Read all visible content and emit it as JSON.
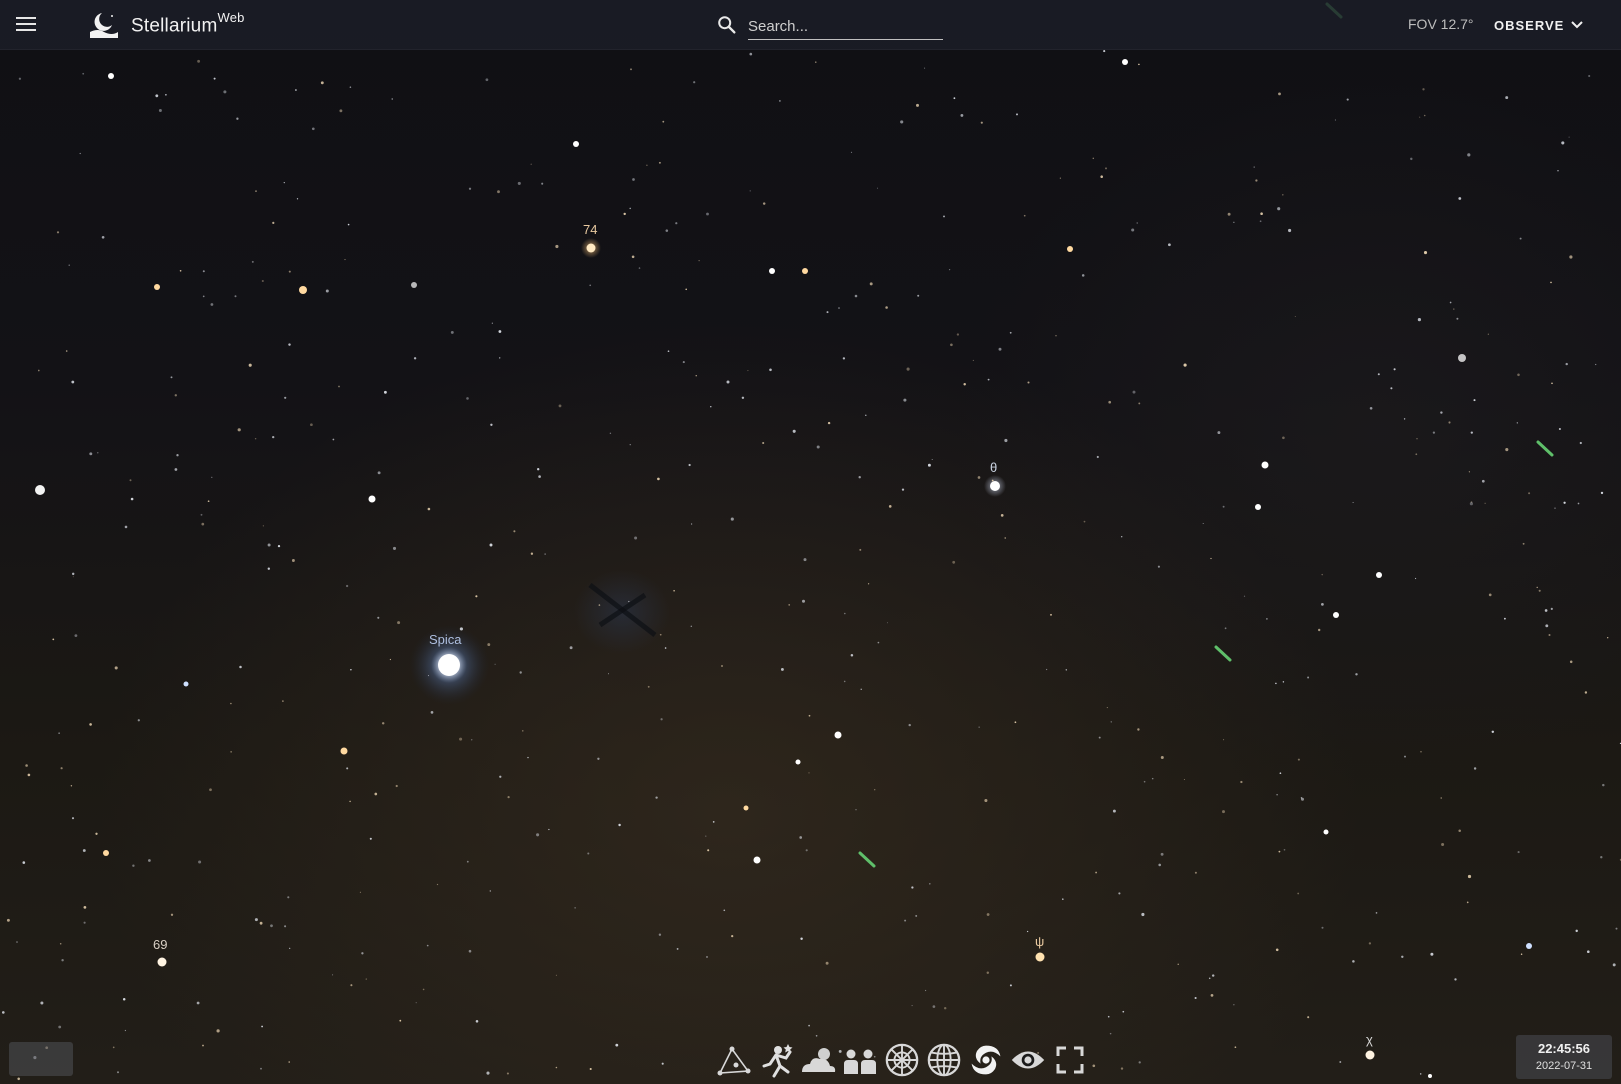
{
  "app": {
    "title": "Stellarium",
    "title_suffix": "Web"
  },
  "search": {
    "placeholder": "Search..."
  },
  "header": {
    "fov": "FOV 12.7°",
    "observe_label": "OBSERVE"
  },
  "sky_labels": [
    {
      "name": "Spica",
      "color": "#aebfe0"
    },
    {
      "name": "74",
      "color": "#e8c9a0"
    },
    {
      "name": "θ",
      "color": "#c9d2e0"
    },
    {
      "name": "69",
      "color": "#d8cfc4"
    },
    {
      "name": "ψ",
      "color": "#e8c9a0"
    },
    {
      "name": "χ",
      "color": "#d8d8d8"
    }
  ],
  "bottom_toolbar": [
    {
      "icon": "constellation-lines-icon"
    },
    {
      "icon": "constellation-art-icon"
    },
    {
      "icon": "atmosphere-icon"
    },
    {
      "icon": "landscape-icon"
    },
    {
      "icon": "azimuthal-grid-icon"
    },
    {
      "icon": "equatorial-grid-icon"
    },
    {
      "icon": "deep-sky-objects-icon"
    },
    {
      "icon": "night-mode-eye-icon"
    },
    {
      "icon": "fullscreen-icon"
    }
  ],
  "datetime": {
    "time": "22:45:56",
    "date": "2022-07-31"
  },
  "colors": {
    "toolbar_bg": "#1c1e28",
    "satellite": "#5fbf6a",
    "spica": "#cfe0ff"
  }
}
